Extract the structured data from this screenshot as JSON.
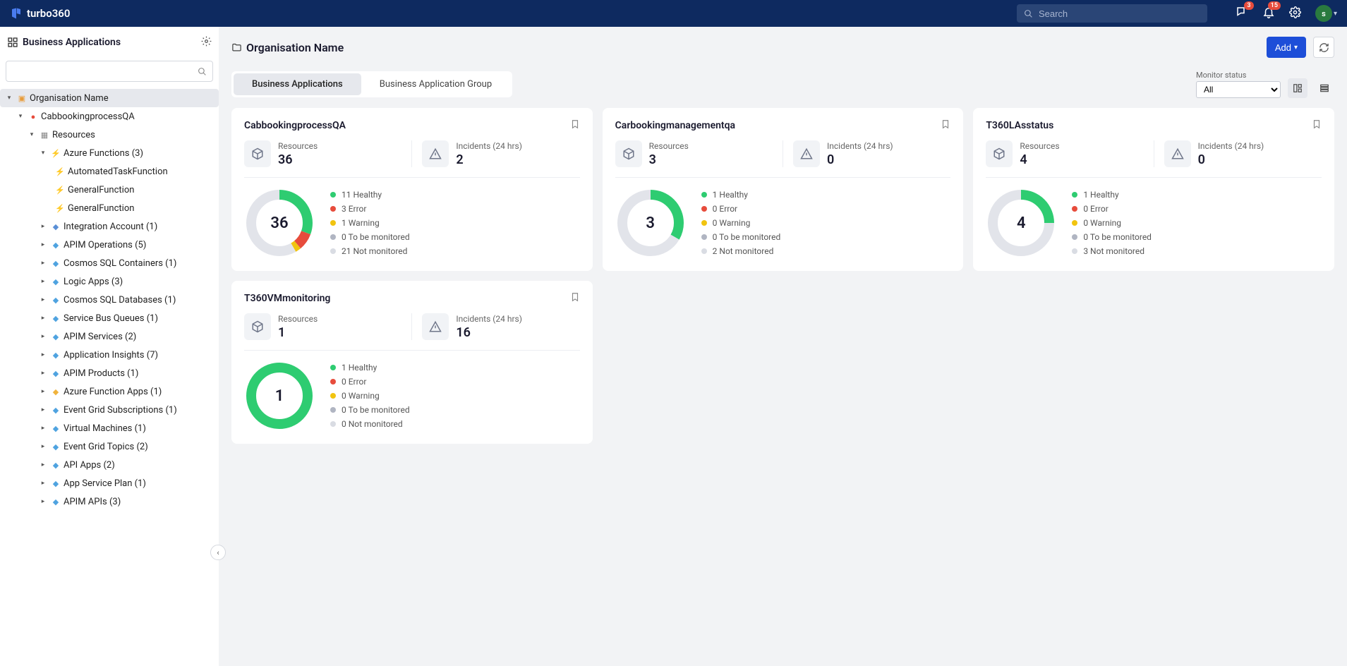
{
  "header": {
    "brand": "turbo360",
    "search_placeholder": "Search",
    "badge_connect": "3",
    "badge_bell": "15",
    "avatar_letter": "s"
  },
  "sidebar": {
    "title": "Business Applications",
    "root": {
      "label": "Organisation Name"
    },
    "l1": {
      "label": "CabbookingprocessQA"
    },
    "l2": {
      "label": "Resources"
    },
    "az_functions": {
      "label": "Azure Functions (3)"
    },
    "az_f_items": [
      {
        "label": "AutomatedTaskFunction"
      },
      {
        "label": "GeneralFunction"
      },
      {
        "label": "GeneralFunction"
      }
    ],
    "rest": [
      {
        "label": "Integration Account (1)",
        "icon_color": "#5a8fd6"
      },
      {
        "label": "APIM Operations (5)",
        "icon_color": "#4fa3e0"
      },
      {
        "label": "Cosmos SQL Containers (1)",
        "icon_color": "#4fa3e0"
      },
      {
        "label": "Logic Apps (3)",
        "icon_color": "#4fa3e0"
      },
      {
        "label": "Cosmos SQL Databases (1)",
        "icon_color": "#4fa3e0"
      },
      {
        "label": "Service Bus Queues (1)",
        "icon_color": "#4fa3e0"
      },
      {
        "label": "APIM Services (2)",
        "icon_color": "#4fa3e0"
      },
      {
        "label": "Application Insights (7)",
        "icon_color": "#4fa3e0"
      },
      {
        "label": "APIM Products (1)",
        "icon_color": "#4fa3e0"
      },
      {
        "label": "Azure Function Apps (1)",
        "icon_color": "#f0b33c"
      },
      {
        "label": "Event Grid Subscriptions (1)",
        "icon_color": "#4fa3e0"
      },
      {
        "label": "Virtual Machines (1)",
        "icon_color": "#4fa3e0"
      },
      {
        "label": "Event Grid Topics (2)",
        "icon_color": "#4fa3e0"
      },
      {
        "label": "API Apps (2)",
        "icon_color": "#4fa3e0"
      },
      {
        "label": "App Service Plan (1)",
        "icon_color": "#4fa3e0"
      },
      {
        "label": "APIM APIs (3)",
        "icon_color": "#4fa3e0"
      }
    ]
  },
  "main": {
    "title": "Organisation Name",
    "add_btn": "Add",
    "tab1": "Business Applications",
    "tab2": "Business Application Group",
    "filter_label": "Monitor status",
    "filter_value": "All"
  },
  "status_labels": {
    "healthy": "Healthy",
    "error": "Error",
    "warning": "Warning",
    "tbm": "To be monitored",
    "nm": "Not monitored",
    "resources": "Resources",
    "incidents": "Incidents (24 hrs)"
  },
  "cards": [
    {
      "title": "CabbookingprocessQA",
      "resources": "36",
      "incidents": "2",
      "healthy": 11,
      "error": 3,
      "warning": 1,
      "tbm": 0,
      "nm": 21
    },
    {
      "title": "Carbookingmanagementqa",
      "resources": "3",
      "incidents": "0",
      "healthy": 1,
      "error": 0,
      "warning": 0,
      "tbm": 0,
      "nm": 2
    },
    {
      "title": "T360LAsstatus",
      "resources": "4",
      "incidents": "0",
      "healthy": 1,
      "error": 0,
      "warning": 0,
      "tbm": 0,
      "nm": 3
    },
    {
      "title": "T360VMmonitoring",
      "resources": "1",
      "incidents": "16",
      "healthy": 1,
      "error": 0,
      "warning": 0,
      "tbm": 0,
      "nm": 0
    }
  ],
  "chart_data": {
    "type": "pie",
    "note": "Each card has a donut with segments healthy/error/warning/tbm/nm; values equal to counts in cards[]"
  }
}
